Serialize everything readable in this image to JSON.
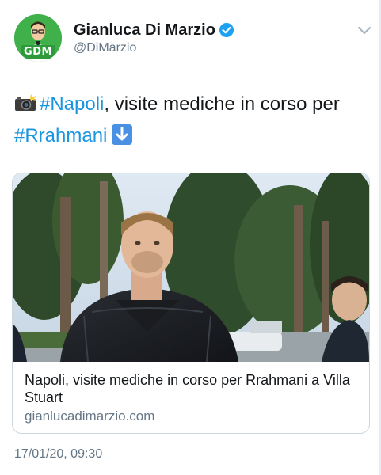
{
  "author": {
    "display_name": "Gianluca Di Marzio",
    "handle": "@DiMarzio",
    "avatar_badge": "GDM",
    "verified": true
  },
  "tweet": {
    "text_part1": "#Napoli",
    "text_part2": ", visite mediche in corso per",
    "text_part3": "#Rrahmani",
    "emoji_lead": "camera-flash-icon",
    "emoji_trail": "down-arrow-icon"
  },
  "card": {
    "title": "Napoli, visite mediche in corso per Rrahmani a Villa Stuart",
    "domain": "gianlucadimarzio.com"
  },
  "timestamp": "17/01/20, 09:30",
  "colors": {
    "hashtag": "#1b95e0",
    "verified": "#1da1f2",
    "avatar_bg": "#3fb04a",
    "secondary_text": "#657786"
  }
}
